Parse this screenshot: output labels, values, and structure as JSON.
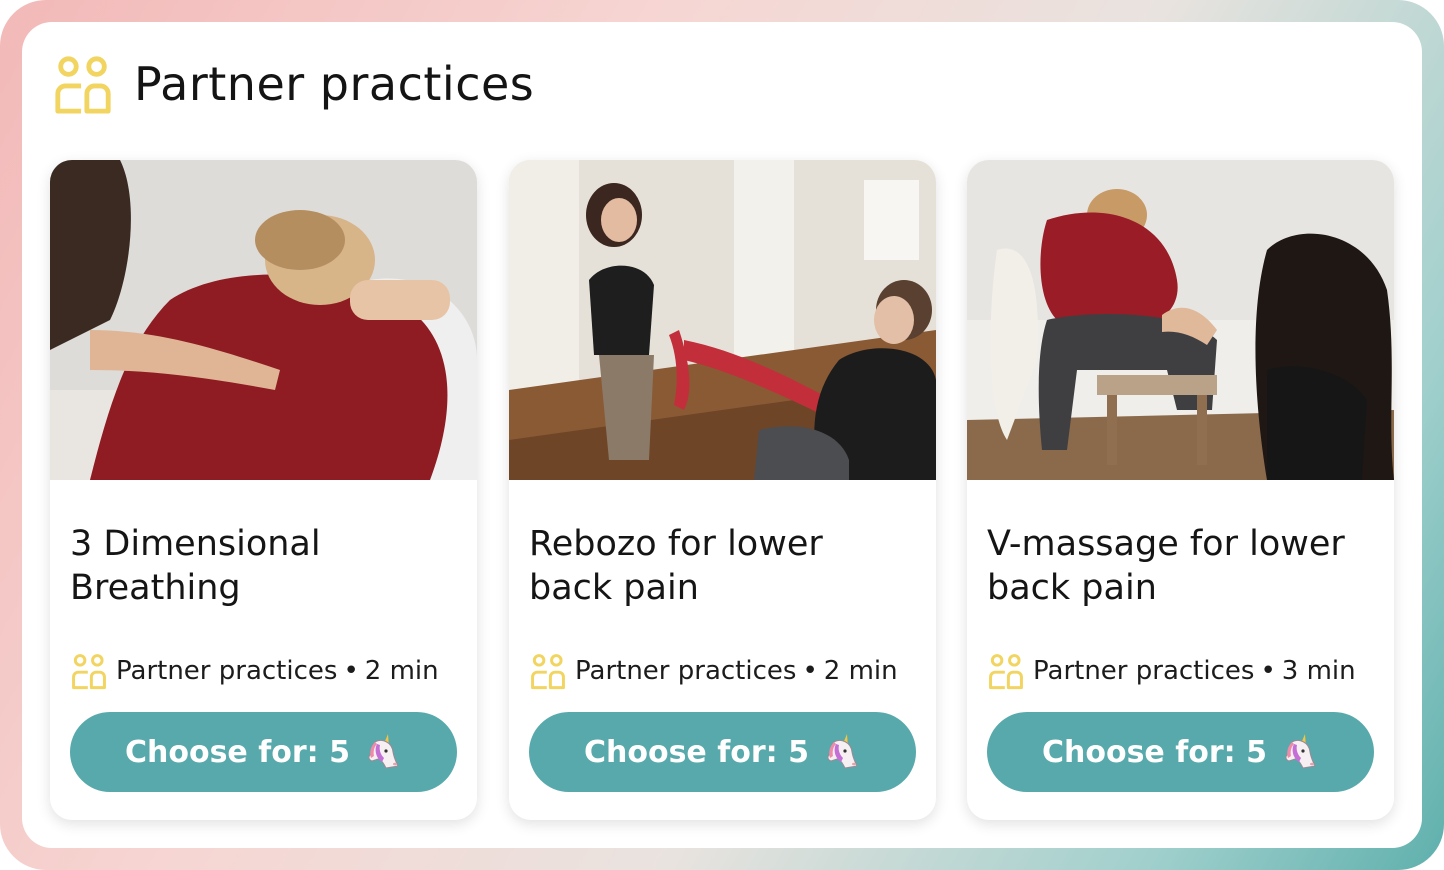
{
  "header": {
    "title": "Partner practices",
    "icon": "partner-icon"
  },
  "colors": {
    "accent": "#57a9ab",
    "icon": "#f2d460",
    "text": "#151515"
  },
  "cards": [
    {
      "title_line1": "3 Dimensional",
      "title_line2": "Breathing",
      "category": "Partner practices",
      "separator": "•",
      "duration": "2 min",
      "button_label": "Choose for: 5",
      "button_icon": "unicorn-icon",
      "image": "photo-woman-red-sweater-back-massage"
    },
    {
      "title_line1": "Rebozo for lower",
      "title_line2": "back pain",
      "category": "Partner practices",
      "separator": "•",
      "duration": "2 min",
      "button_label": "Choose for: 5",
      "button_icon": "unicorn-icon",
      "image": "photo-rebozo-red-scarf"
    },
    {
      "title_line1": "V-massage for lower",
      "title_line2": "back pain",
      "category": "Partner practices",
      "separator": "•",
      "duration": "3 min",
      "button_label": "Choose for: 5",
      "button_icon": "unicorn-icon",
      "image": "photo-v-massage-chair"
    }
  ]
}
